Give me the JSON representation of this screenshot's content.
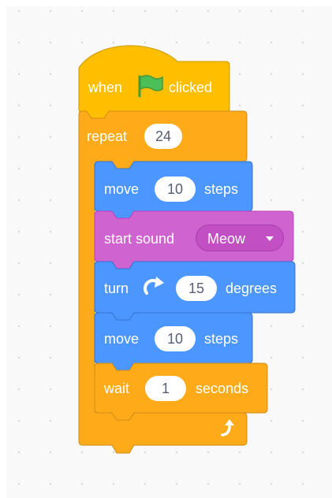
{
  "hat_block": {
    "word_when": "when",
    "flag_icon": "green-flag-icon",
    "word_clicked": "clicked"
  },
  "repeat_block": {
    "label": "repeat",
    "count": "24",
    "loop_icon": "loop-arrow-icon"
  },
  "move_block_1": {
    "label": "move",
    "value": "10",
    "unit": "steps"
  },
  "sound_block": {
    "label": "start sound",
    "sound": "Meow",
    "caret_icon": "caret-down-icon"
  },
  "turn_block": {
    "label": "turn",
    "direction_icon": "rotate-clockwise-icon",
    "value": "15",
    "unit": "degrees"
  },
  "move_block_2": {
    "label": "move",
    "value": "10",
    "unit": "steps"
  },
  "wait_block": {
    "label": "wait",
    "value": "1",
    "unit": "seconds"
  },
  "colors": {
    "events": "#ffbf00",
    "control": "#ffab19",
    "motion": "#4c97ff",
    "sound": "#cf63cf",
    "workspace": "#f9f9f9"
  }
}
